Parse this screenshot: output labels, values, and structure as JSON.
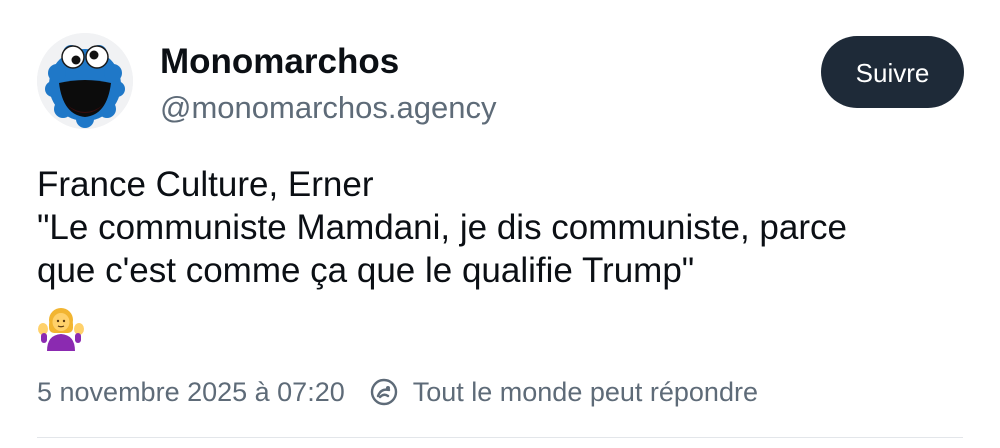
{
  "author": {
    "display_name": "Monomarchos",
    "handle": "@monomarchos.agency",
    "avatar_icon": "cookie-monster-avatar"
  },
  "follow_button": {
    "label": "Suivre"
  },
  "post": {
    "lines": [
      "France Culture, Erner",
      "\"Le communiste Mamdani, je dis communiste, parce",
      "que c'est comme ça que le qualifie Trump\""
    ],
    "emoji_icon": "person-shrugging-emoji"
  },
  "meta": {
    "timestamp": "5 novembre 2025 à 07:20",
    "reply_icon": "reply-settings-icon",
    "reply_setting": "Tout le monde peut répondre"
  },
  "colors": {
    "button_bg": "#1e2a38",
    "secondary_text": "#5e6b78",
    "avatar_blue": "#1f78c8"
  }
}
